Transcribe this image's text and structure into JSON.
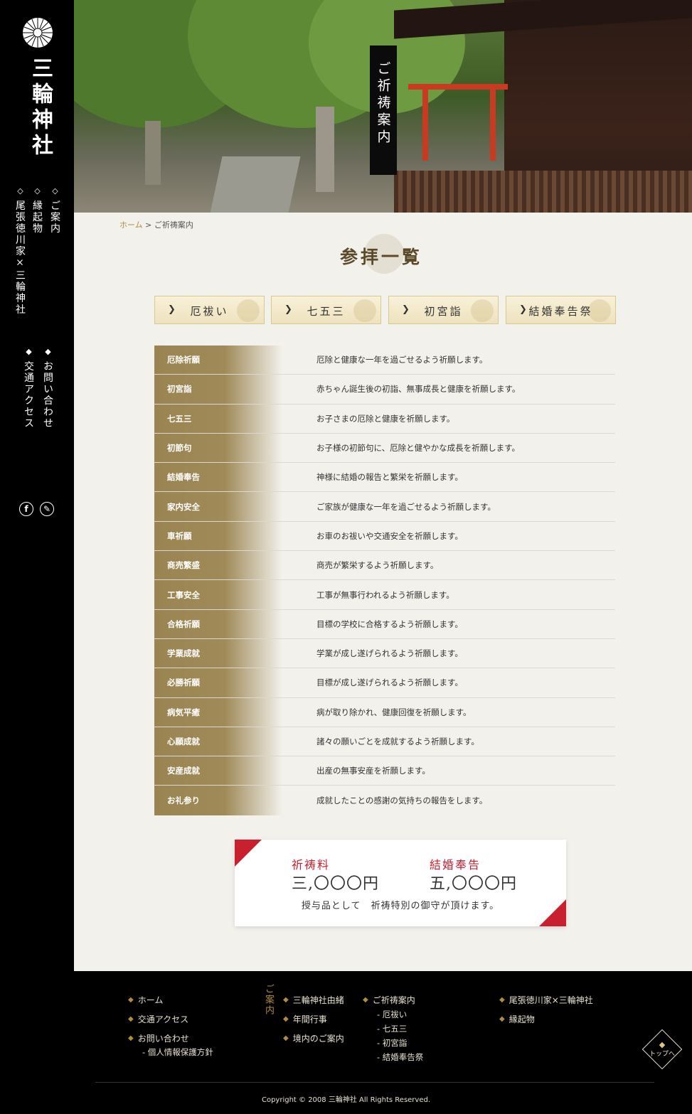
{
  "sidebar": {
    "site_name": "三輪神社",
    "nav": [
      {
        "label": "ご案内"
      },
      {
        "label": "縁起物"
      },
      {
        "label": "尾張徳川家×三輪神社"
      },
      {
        "label": "お問い合わせ"
      },
      {
        "label": "交通アクセス"
      }
    ],
    "icons": [
      "facebook-icon",
      "pen-icon"
    ]
  },
  "hero": {
    "label": "ご祈祷案内"
  },
  "breadcrumb": {
    "home": "ホーム",
    "sep": " > ",
    "current": "ご祈祷案内"
  },
  "main": {
    "title": "参拝一覧",
    "tabs": [
      {
        "label": "厄祓い"
      },
      {
        "label": "七五三"
      },
      {
        "label": "初宮詣"
      },
      {
        "label": "結婚奉告祭"
      }
    ],
    "prayers": [
      {
        "name": "厄除祈願",
        "desc": "厄除と健康な一年を過ごせるよう祈願します。"
      },
      {
        "name": "初宮詣",
        "desc": "赤ちゃん誕生後の初詣、無事成長と健康を祈願します。"
      },
      {
        "name": "七五三",
        "desc": "お子さまの厄除と健康を祈願します。"
      },
      {
        "name": "初節句",
        "desc": "お子様の初節句に、厄除と健やかな成長を祈願します。"
      },
      {
        "name": "結婚奉告",
        "desc": "神様に結婚の報告と繁栄を祈願します。"
      },
      {
        "name": "家内安全",
        "desc": "ご家族が健康な一年を過ごせるよう祈願します。"
      },
      {
        "name": "車祈願",
        "desc": "お車のお祓いや交通安全を祈願します。"
      },
      {
        "name": "商売繁盛",
        "desc": "商売が繁栄するよう祈願します。"
      },
      {
        "name": "工事安全",
        "desc": "工事が無事行われるよう祈願します。"
      },
      {
        "name": "合格祈願",
        "desc": "目標の学校に合格するよう祈願します。"
      },
      {
        "name": "学業成就",
        "desc": "学業が成し遂げられるよう祈願します。"
      },
      {
        "name": "必勝祈願",
        "desc": "目標が成し遂げられるよう祈願します。"
      },
      {
        "name": "病気平癒",
        "desc": "病が取り除かれ、健康回復を祈願します。"
      },
      {
        "name": "心願成就",
        "desc": "諸々の願いごとを成就するよう祈願します。"
      },
      {
        "name": "安産成就",
        "desc": "出産の無事安産を祈願します。"
      },
      {
        "name": "お礼参り",
        "desc": "成就したことの感謝の気持ちの報告をします。"
      }
    ],
    "fees": [
      {
        "label": "祈祷料",
        "amount": "三,〇〇〇円"
      },
      {
        "label": "結婚奉告",
        "amount": "五,〇〇〇円"
      }
    ],
    "fee_note": "授与品として　祈祷特別の御守が頂けます。"
  },
  "footer": {
    "col1": [
      "ホーム",
      "交通アクセス",
      "お問い合わせ"
    ],
    "col1_sub": [
      "- 個人情報保護方針"
    ],
    "vertical_label": "ご案内",
    "col2": [
      "三輪神社由緒",
      "年間行事",
      "境内のご案内"
    ],
    "col3_title": "ご祈祷案内",
    "col3_sub": [
      "- 厄祓い",
      "- 七五三",
      "- 初宮詣",
      "- 結婚奉告祭"
    ],
    "col4": [
      "尾張徳川家×三輪神社",
      "縁起物"
    ],
    "to_top": "トップへ",
    "copyright": "Copyright © 2008 三輪神社 All Rights Reserved."
  },
  "colors": {
    "accent_gold": "#b08d3f",
    "accent_red": "#c8202f",
    "list_band": "#9a8452",
    "page_bg": "#f3f1ec"
  }
}
